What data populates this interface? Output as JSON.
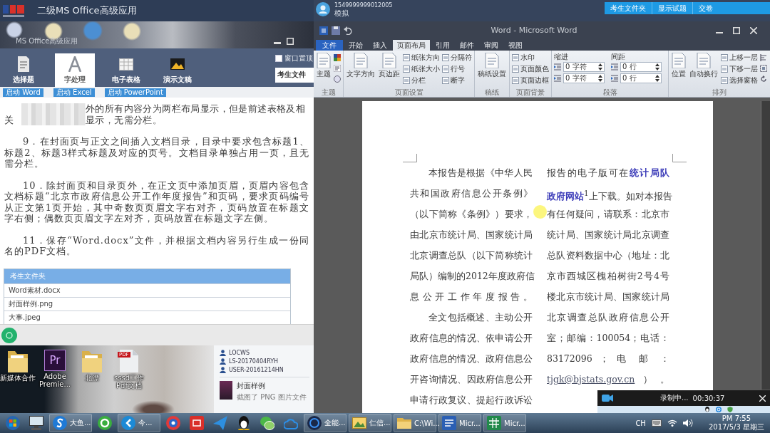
{
  "exam_app": {
    "title": "二级MS Office高级应用",
    "window_caption": "MS Office高级应用",
    "nav_tabs": [
      {
        "kind": "choice",
        "label": "选择题",
        "selected": false
      },
      {
        "kind": "word",
        "label": "字处理",
        "selected": true
      },
      {
        "kind": "excel",
        "label": "电子表格",
        "selected": false
      },
      {
        "kind": "ppt",
        "label": "演示文稿",
        "selected": false
      }
    ],
    "option_checkbox": {
      "label": "窗口置顶",
      "checked": false
    },
    "folder_button": "考生文件",
    "launch_buttons": [
      "启动 Word",
      "启动 Excel",
      "启动 PowerPoint"
    ],
    "instructions": [
      {
        "kind": "masked",
        "line_1": "外的所有内容分为两栏布局显示，但是前述表格及相",
        "line_2_start": "关",
        "line_2_end": "显示，无需分栏。"
      },
      {
        "kind": "plain",
        "text": "9．在封面页与正文之间插入文档目录，目录中要求包含标题1、标题2、标题3样式标题及对应的页号。文档目录单独占用一页，且无需分栏。"
      },
      {
        "kind": "plain",
        "text": "10．除封面页和目录页外，在正文页中添加页眉，页眉内容包含文档标题“北京市政府信息公开工作年度报告”和页码，要求页码编号从正文第1页开始，其中奇数页页眉文字右对齐，页码放置在标题文字右侧；偶数页页眉文字左对齐，页码放置在标题文字左侧。"
      },
      {
        "kind": "plain",
        "text": "11．保存“Word.docx”文件，并根据文档内容另行生成一份同名的PDF文档。"
      }
    ],
    "file_list": {
      "header": "考生文件夹",
      "files": [
        "Word素材.docx",
        "封面样例.png",
        "大事.jpeg"
      ]
    }
  },
  "desktop": {
    "icons": [
      {
        "kind": "folder",
        "label": "新媒体合作"
      },
      {
        "kind": "app",
        "badge": "Pr",
        "label": "Adobe Premie..."
      },
      {
        "kind": "folder",
        "label": "北漂"
      },
      {
        "kind": "pdf",
        "badge": "PDF",
        "label": "sssd工作 Pdf文档"
      }
    ],
    "network_items": [
      "LOCWS",
      "LS-20170404RYH",
      "USER-20161214HN"
    ],
    "notification": {
      "title": "封面样例",
      "detail": "截图了 PNG 图片文件"
    }
  },
  "exam_bar": {
    "candidate_id": "1549999999012005",
    "candidate_name": "模拟",
    "buttons": [
      "考生文件夹",
      "显示试题",
      "交卷"
    ]
  },
  "word": {
    "title": "Word - Microsoft Word",
    "tabs": [
      {
        "label": "文件",
        "kind": "file",
        "selected": false
      },
      {
        "label": "开始",
        "kind": "tab",
        "selected": false
      },
      {
        "label": "插入",
        "kind": "tab",
        "selected": false
      },
      {
        "label": "页面布局",
        "kind": "tab",
        "selected": true
      },
      {
        "label": "引用",
        "kind": "tab",
        "selected": false
      },
      {
        "label": "邮件",
        "kind": "tab",
        "selected": false
      },
      {
        "label": "审阅",
        "kind": "tab",
        "selected": false
      },
      {
        "label": "视图",
        "kind": "tab",
        "selected": false
      }
    ],
    "ribbon_groups": [
      {
        "label": "主题",
        "kind": "theme",
        "large": [
          "主题"
        ]
      },
      {
        "label": "页面设置",
        "kind": "buttons",
        "large": [
          "文字方向",
          "页边距"
        ],
        "small": [
          [
            "纸张方向",
            "纸张大小",
            "分栏"
          ],
          [
            "分隔符",
            "行号",
            "断字"
          ]
        ]
      },
      {
        "label": "稿纸",
        "kind": "buttons",
        "large": [
          "稿纸设置"
        ]
      },
      {
        "label": "页面背景",
        "kind": "buttons",
        "small": [
          [
            "水印",
            "页面颜色",
            "页面边框"
          ]
        ]
      },
      {
        "label": "段落",
        "kind": "paragraph",
        "sections": [
          {
            "heading": "缩进",
            "fields": [
              "0 字符",
              "0 字符"
            ]
          },
          {
            "heading": "间距",
            "fields": [
              "0 行",
              "0 行"
            ]
          }
        ]
      },
      {
        "label": "排列",
        "kind": "arrange",
        "large": [
          "位置",
          "自动换行"
        ],
        "small": [
          [
            "上移一层",
            "下移一层",
            "选择窗格"
          ]
        ]
      }
    ],
    "document": {
      "columns": [
        {
          "paragraphs": [
            {
              "first_line_indent": true,
              "lines": [
                [
                  {
                    "kind": "text",
                    "text": "本报告是根据《中华人民"
                  }
                ],
                [
                  {
                    "kind": "text",
                    "text": "共和国政府信息公开条例》"
                  }
                ],
                [
                  {
                    "kind": "text",
                    "text": "（以下简称《条例》）要求，"
                  }
                ],
                [
                  {
                    "kind": "text",
                    "text": "由北京市统计局、国家统计局"
                  }
                ],
                [
                  {
                    "kind": "text",
                    "text": "北京调查总队（以下简称统计"
                  }
                ],
                [
                  {
                    "kind": "text",
                    "text": "局队）编制的2012年度政府信"
                  }
                ],
                [
                  {
                    "kind": "text",
                    "text": "息公开工作年度报告。"
                  }
                ]
              ]
            },
            {
              "first_line_indent": true,
              "lines": [
                [
                  {
                    "kind": "text",
                    "text": "全文包括概述、主动公开"
                  }
                ],
                [
                  {
                    "kind": "text",
                    "text": "政府信息的情况、依申请公开"
                  }
                ],
                [
                  {
                    "kind": "text",
                    "text": "政府信息的情况、政府信息公"
                  }
                ],
                [
                  {
                    "kind": "text",
                    "text": "开咨询情况、因政府信息公开"
                  }
                ],
                [
                  {
                    "kind": "text",
                    "text": "申请行政复议、提起行政诉讼"
                  }
                ]
              ]
            }
          ]
        },
        {
          "paragraphs": [
            {
              "first_line_indent": false,
              "lines": [
                [
                  {
                    "kind": "text",
                    "text": "报告的电子版可在"
                  },
                  {
                    "kind": "link",
                    "text": "统计局队"
                  }
                ],
                [
                  {
                    "kind": "link",
                    "text": "政府网站"
                  },
                  {
                    "kind": "text",
                    "text": "$^{1}$上下载。如对本报告"
                  }
                ],
                [
                  {
                    "kind": "text",
                    "text": "有任何疑问，请联系：北京市"
                  }
                ],
                [
                  {
                    "kind": "text",
                    "text": "统计局、国家统计局北京调查"
                  }
                ],
                [
                  {
                    "kind": "text",
                    "text": "总队资料数据中心（地址：北"
                  }
                ],
                [
                  {
                    "kind": "text",
                    "text": "京市西城区槐柏树街2号4号"
                  }
                ],
                [
                  {
                    "kind": "text",
                    "text": "楼北京市统计局、国家统计局"
                  }
                ],
                [
                  {
                    "kind": "text",
                    "text": "北京调查总队政府信息公开"
                  }
                ],
                [
                  {
                    "kind": "text",
                    "text": "室；邮编：100054；电话："
                  }
                ],
                [
                  {
                    "kind": "text",
                    "text": "83172096 ； 电 邮 ："
                  }
                ],
                [
                  {
                    "kind": "email",
                    "text": "tjgk@bjstats.gov.cn"
                  },
                  {
                    "kind": "text",
                    "text": "）。"
                  }
                ]
              ]
            }
          ]
        }
      ]
    }
  },
  "recorder": {
    "status": "录制中...",
    "elapsed": "00:30:37"
  },
  "taskbar": {
    "items": [
      {
        "kind": "start"
      },
      {
        "kind": "monitor"
      },
      {
        "kind": "swirl",
        "label": "大鱼..."
      },
      {
        "kind": "ring"
      },
      {
        "kind": "chevron",
        "label": "今..."
      },
      {
        "kind": "target"
      },
      {
        "kind": "tile"
      },
      {
        "kind": "plane"
      },
      {
        "kind": "penguin"
      },
      {
        "kind": "chat"
      },
      {
        "kind": "cloud"
      },
      {
        "kind": "disc",
        "label": "全能..."
      },
      {
        "kind": "picture",
        "label": "仁信..."
      },
      {
        "kind": "folder",
        "label": "C:\\Wi..."
      },
      {
        "kind": "word",
        "label": "Micr..."
      },
      {
        "kind": "excel",
        "label": "Micr..."
      }
    ],
    "language": "CH",
    "time": "PM 7:55",
    "date": "2017/5/3 星期三"
  }
}
